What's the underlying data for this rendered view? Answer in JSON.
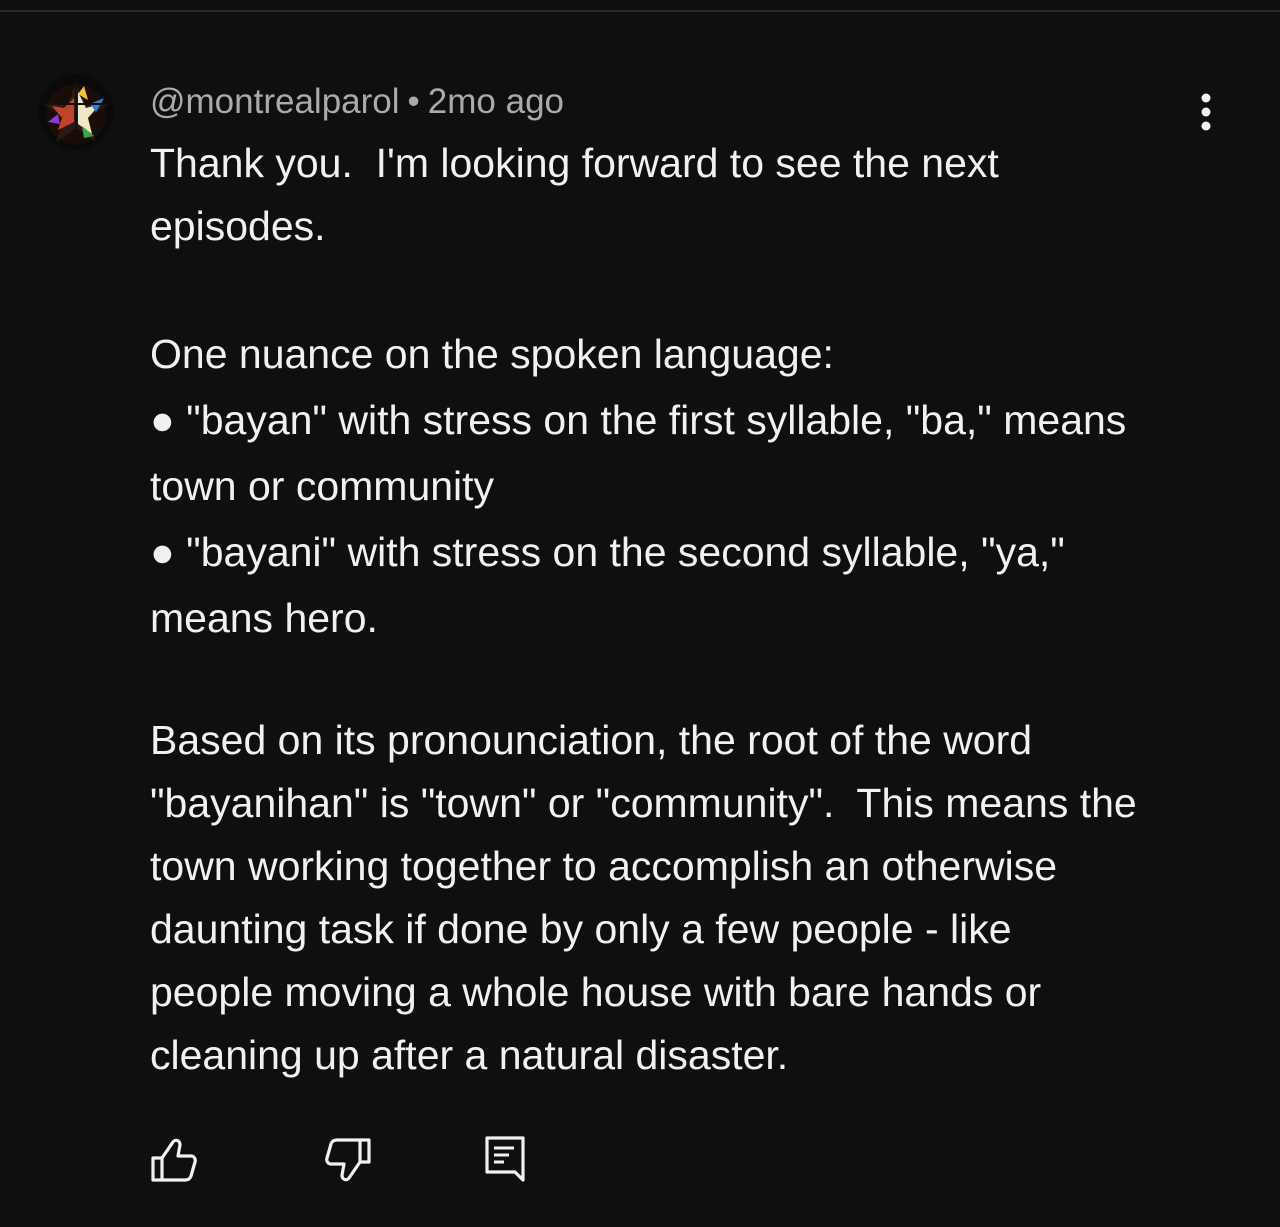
{
  "comment": {
    "author": "@montrealparol",
    "separator": "•",
    "timestamp": "2mo ago",
    "paragraph_1": "Thank you.  I'm looking forward to see the next\nepisodes.",
    "paragraph_2": "One nuance on the spoken language:\n● \"bayan\" with stress on the first syllable, \"ba,\" means\ntown or community\n● \"bayani\" with stress on the second syllable, \"ya,\"\nmeans hero.",
    "paragraph_3": "Based on its pronounciation, the root of the word\n\"bayanihan\" is \"town\" or \"community\".  This means the\ntown working together to accomplish an otherwise\ndaunting task if done by only a few people - like\npeople moving a whole house with bare hands or\ncleaning up after a natural disaster."
  },
  "icons": {
    "more": "more-vertical-icon",
    "like": "thumbs-up-icon",
    "dislike": "thumbs-down-icon",
    "reply": "reply-comment-icon"
  },
  "colors": {
    "background": "#0f0f0f",
    "text_primary": "#f1f1f1",
    "text_secondary": "#aaaaaa"
  }
}
